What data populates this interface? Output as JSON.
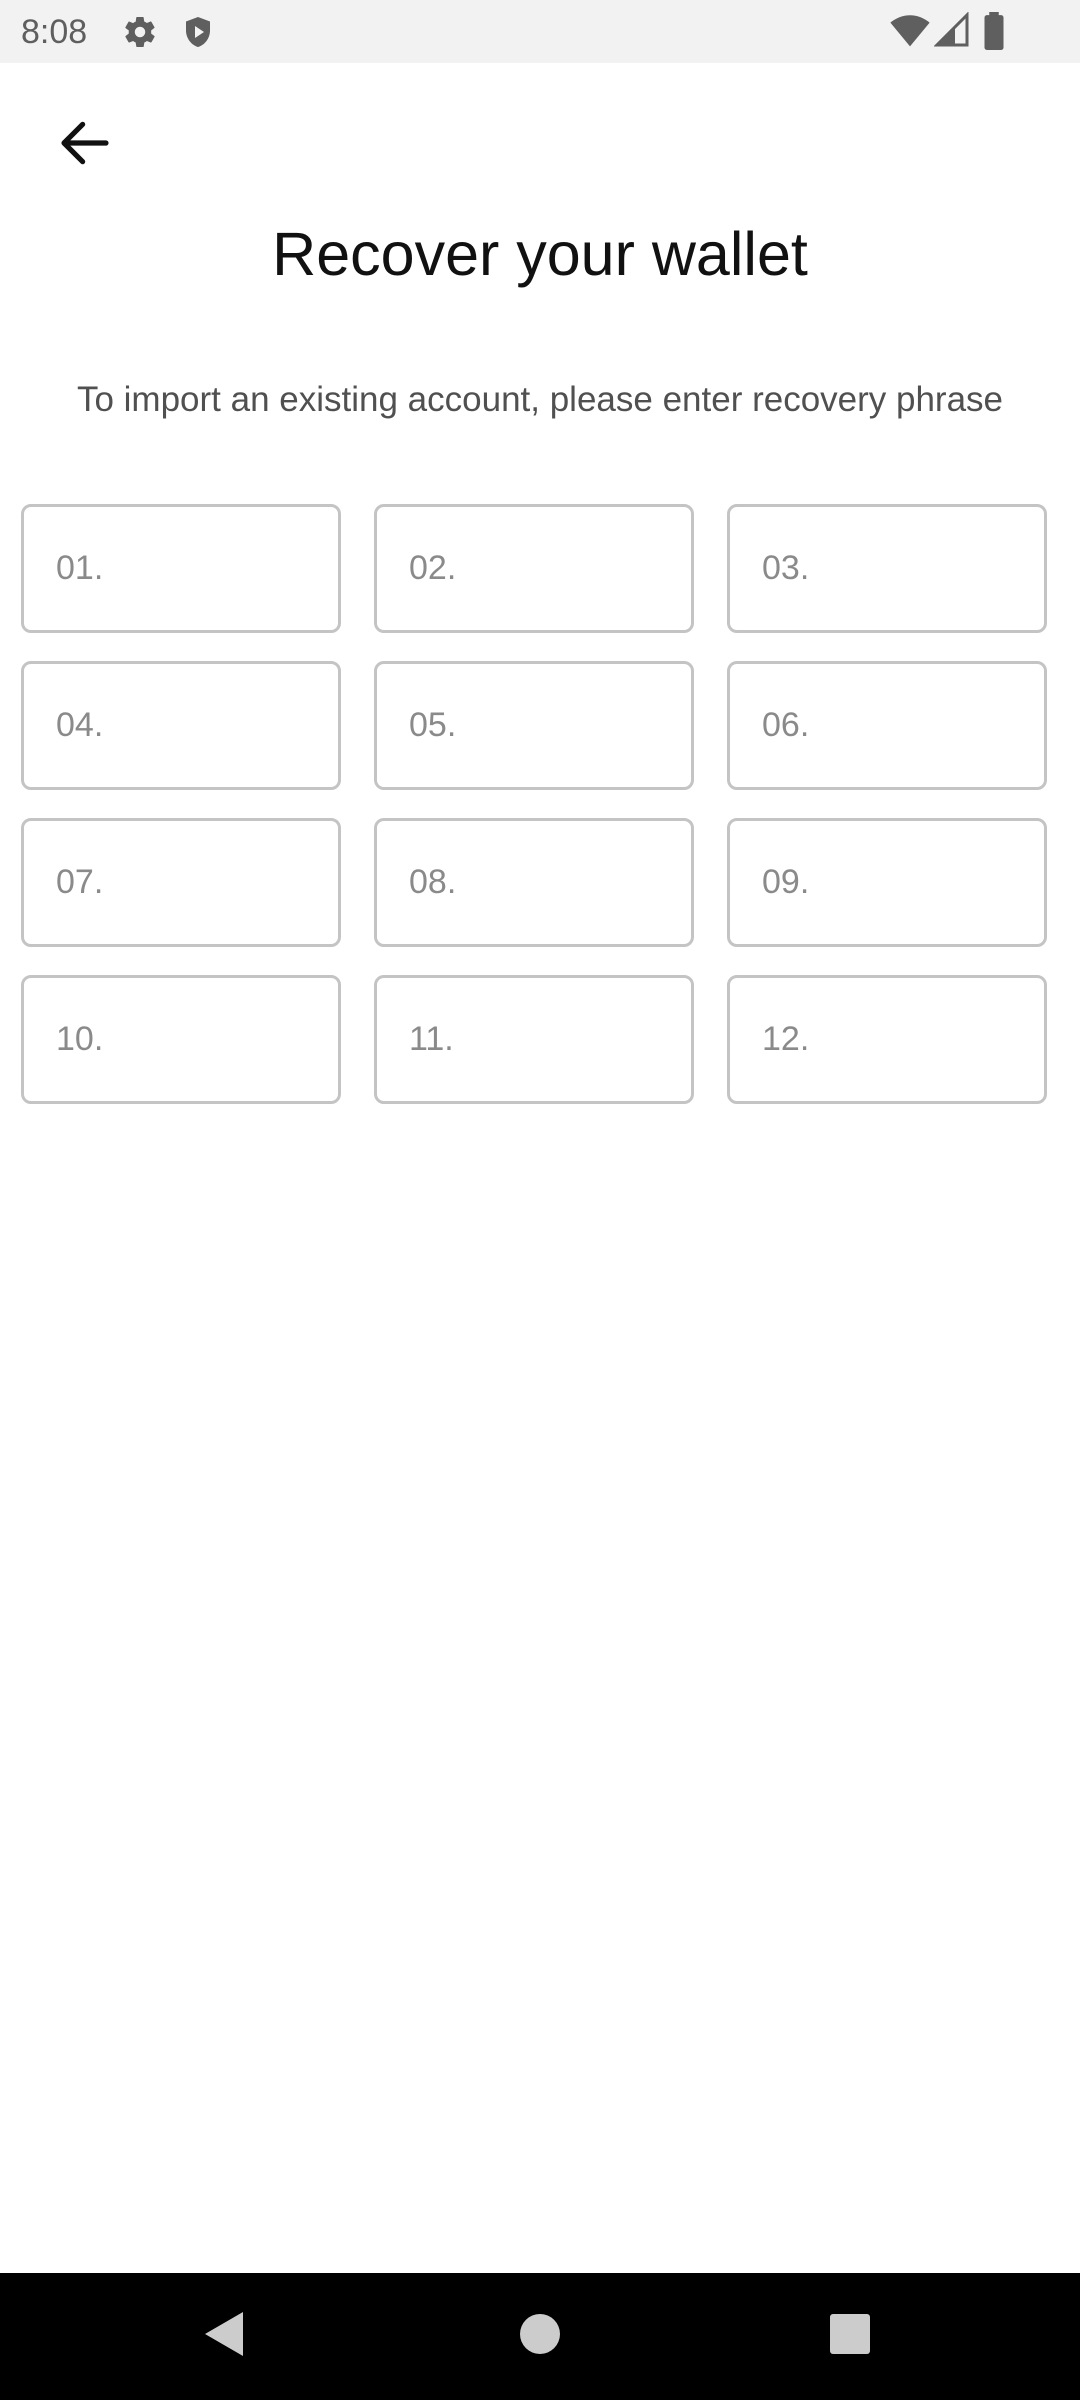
{
  "status_bar": {
    "time": "8:08",
    "icons": [
      "gear-icon",
      "shield-icon",
      "wifi-icon",
      "signal-icon",
      "battery-icon"
    ]
  },
  "header": {
    "back_icon": "arrow-left-icon",
    "title": "Recover your wallet",
    "subtitle": "To import an existing account, please enter recovery phrase"
  },
  "recovery_phrase": {
    "fields": [
      {
        "placeholder": "01.",
        "value": ""
      },
      {
        "placeholder": "02.",
        "value": ""
      },
      {
        "placeholder": "03.",
        "value": ""
      },
      {
        "placeholder": "04.",
        "value": ""
      },
      {
        "placeholder": "05.",
        "value": ""
      },
      {
        "placeholder": "06.",
        "value": ""
      },
      {
        "placeholder": "07.",
        "value": ""
      },
      {
        "placeholder": "08.",
        "value": ""
      },
      {
        "placeholder": "09.",
        "value": ""
      },
      {
        "placeholder": "10.",
        "value": ""
      },
      {
        "placeholder": "11.",
        "value": ""
      },
      {
        "placeholder": "12.",
        "value": ""
      }
    ]
  },
  "nav_bar": {
    "buttons": [
      "back-triangle-icon",
      "home-circle-icon",
      "recents-square-icon"
    ]
  },
  "colors": {
    "status_bar_bg": "#f2f2f2",
    "field_border": "#c4c4c4",
    "placeholder": "#8a8a8a",
    "title": "#111111",
    "nav_bar_bg": "#000000"
  }
}
